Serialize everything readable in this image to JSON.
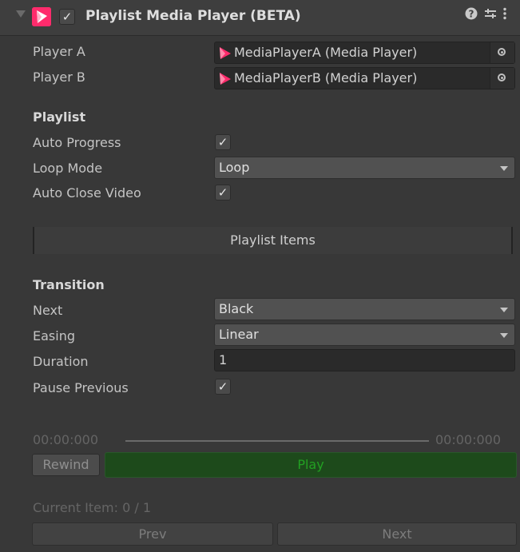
{
  "header": {
    "title": "Playlist Media Player (BETA)",
    "enabled_check": "✓",
    "help_icon": "?",
    "presets_icon": "⇄",
    "menu_icon": "⋮"
  },
  "fields": {
    "player_a": {
      "label": "Player A",
      "value": "MediaPlayerA (Media Player)"
    },
    "player_b": {
      "label": "Player B",
      "value": "MediaPlayerB (Media Player)"
    }
  },
  "playlist": {
    "heading": "Playlist",
    "auto_progress": {
      "label": "Auto Progress",
      "checked": "✓"
    },
    "loop_mode": {
      "label": "Loop Mode",
      "value": "Loop"
    },
    "auto_close_video": {
      "label": "Auto Close Video",
      "checked": "✓"
    },
    "items_button": "Playlist Items"
  },
  "transition": {
    "heading": "Transition",
    "next": {
      "label": "Next",
      "value": "Black"
    },
    "easing": {
      "label": "Easing",
      "value": "Linear"
    },
    "duration": {
      "label": "Duration",
      "value": "1"
    },
    "pause_previous": {
      "label": "Pause Previous",
      "checked": "✓"
    }
  },
  "playback": {
    "time_start": "00:00:000",
    "time_end": "00:00:000",
    "rewind": "Rewind",
    "play": "Play",
    "current_item": "Current Item: 0 / 1",
    "prev": "Prev",
    "next": "Next"
  },
  "colors": {
    "accent": "#ff2b6c",
    "play_bg": "#1d4a1b",
    "play_text": "#22a022"
  },
  "icons": {
    "foldout": "triangle-down-icon",
    "component": "media-player-logo-icon",
    "object_picker": "object-picker-icon"
  }
}
